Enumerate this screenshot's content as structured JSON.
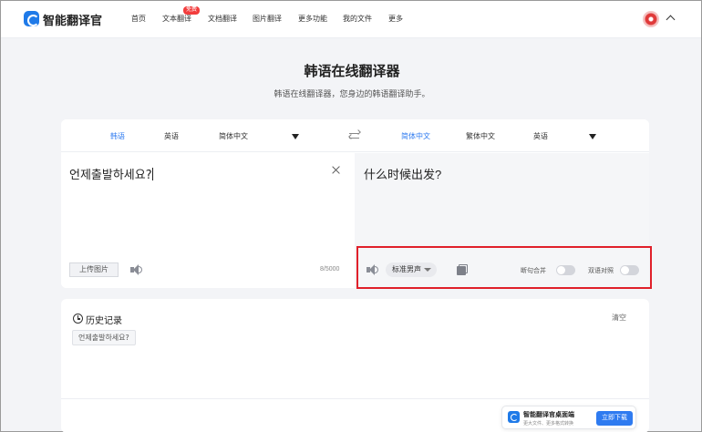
{
  "header": {
    "app_name": "智能翻译官",
    "nav": [
      "首页",
      "文本翻译",
      "文档翻译",
      "图片翻译",
      "更多功能",
      "我的文件",
      "更多"
    ],
    "free_badge": "免费"
  },
  "page": {
    "title": "韩语在线翻译器",
    "subtitle": "韩语在线翻译器，您身边的韩语翻译助手。"
  },
  "lang_bar": {
    "source_langs": [
      "韩语",
      "英语",
      "简体中文"
    ],
    "target_langs": [
      "简体中文",
      "繁体中文",
      "英语"
    ],
    "active_source": "韩语",
    "active_target": "简体中文"
  },
  "source": {
    "text": "언제출발하세요?",
    "upload_label": "上传图片",
    "char_count": "8/5000"
  },
  "target": {
    "text": "什么时候出发?",
    "voice": "标准男声",
    "sentence_merge_label": "断句合并",
    "bilingual_label": "双语对照"
  },
  "history": {
    "title": "历史记录",
    "clear_label": "清空",
    "items": [
      "언제출발하세요?"
    ]
  },
  "promo": {
    "title": "智能翻译官桌面端",
    "subtitle": "更大文件、更多格式转换",
    "button": "立即下载"
  },
  "colors": {
    "accent": "#2f7bf0",
    "highlight_box": "#e0202a",
    "badge": "#f23d3d"
  }
}
